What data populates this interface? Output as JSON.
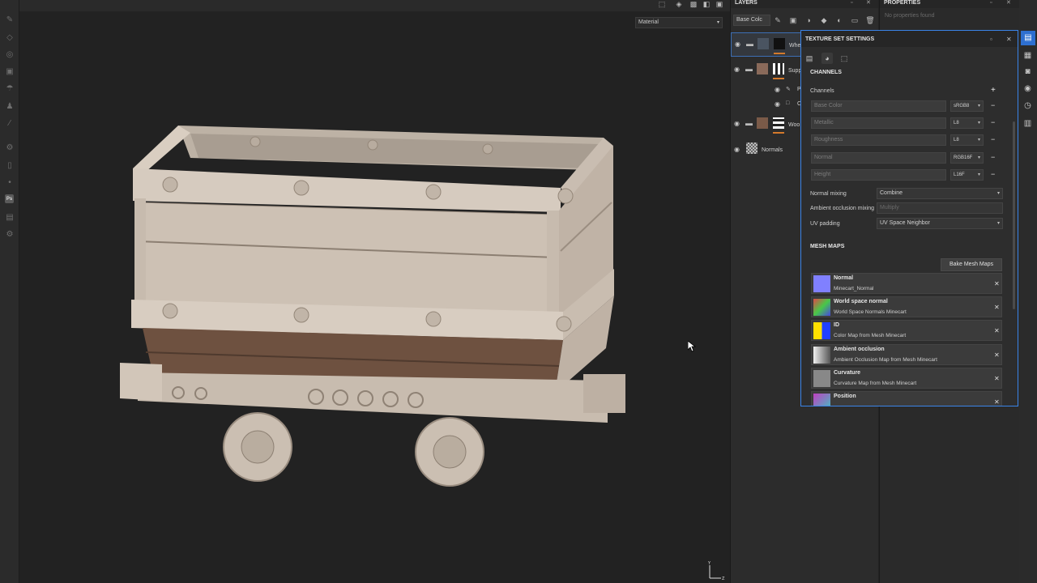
{
  "viewport": {
    "material_select": "Material"
  },
  "layers": {
    "title": "LAYERS",
    "channel_select": "Base Colc",
    "items": [
      {
        "name": "Whe"
      },
      {
        "name": "Supp"
      },
      {
        "name": "P"
      },
      {
        "name": "C"
      },
      {
        "name": "Woo"
      },
      {
        "name": "Normals"
      }
    ]
  },
  "properties": {
    "title": "PROPERTIES",
    "empty_text": "No properties found"
  },
  "texture_set_settings": {
    "title": "TEXTURE SET SETTINGS",
    "channels_title": "CHANNELS",
    "channels_label": "Channels",
    "add_symbol": "+",
    "channels": [
      {
        "name": "Base Color",
        "format": "sRGB8"
      },
      {
        "name": "Metallic",
        "format": "L8"
      },
      {
        "name": "Roughness",
        "format": "L8"
      },
      {
        "name": "Normal",
        "format": "RGB16F"
      },
      {
        "name": "Height",
        "format": "L16F"
      }
    ],
    "normal_mixing_label": "Normal mixing",
    "normal_mixing_value": "Combine",
    "ao_mixing_label": "Ambient occlusion mixing",
    "ao_mixing_value": "Multiply",
    "uv_padding_label": "UV padding",
    "uv_padding_value": "UV Space Neighbor",
    "mesh_maps_title": "MESH MAPS",
    "bake_button": "Bake Mesh Maps",
    "mesh_maps": [
      {
        "name": "Normal",
        "source": "Minecart_Normal"
      },
      {
        "name": "World space normal",
        "source": "World Space Normals Minecart"
      },
      {
        "name": "ID",
        "source": "Color Map from Mesh Minecart"
      },
      {
        "name": "Ambient occlusion",
        "source": "Ambient Occlusion Map from Mesh Minecart"
      },
      {
        "name": "Curvature",
        "source": "Curvature Map from Mesh Minecart"
      },
      {
        "name": "Position",
        "source": ""
      }
    ]
  },
  "colors": {
    "accent": "#3a84e8",
    "layer_mask_orange": "#d47a2c",
    "cart_wood": "#cfc3b5",
    "cart_dark_band": "#6e5140"
  }
}
